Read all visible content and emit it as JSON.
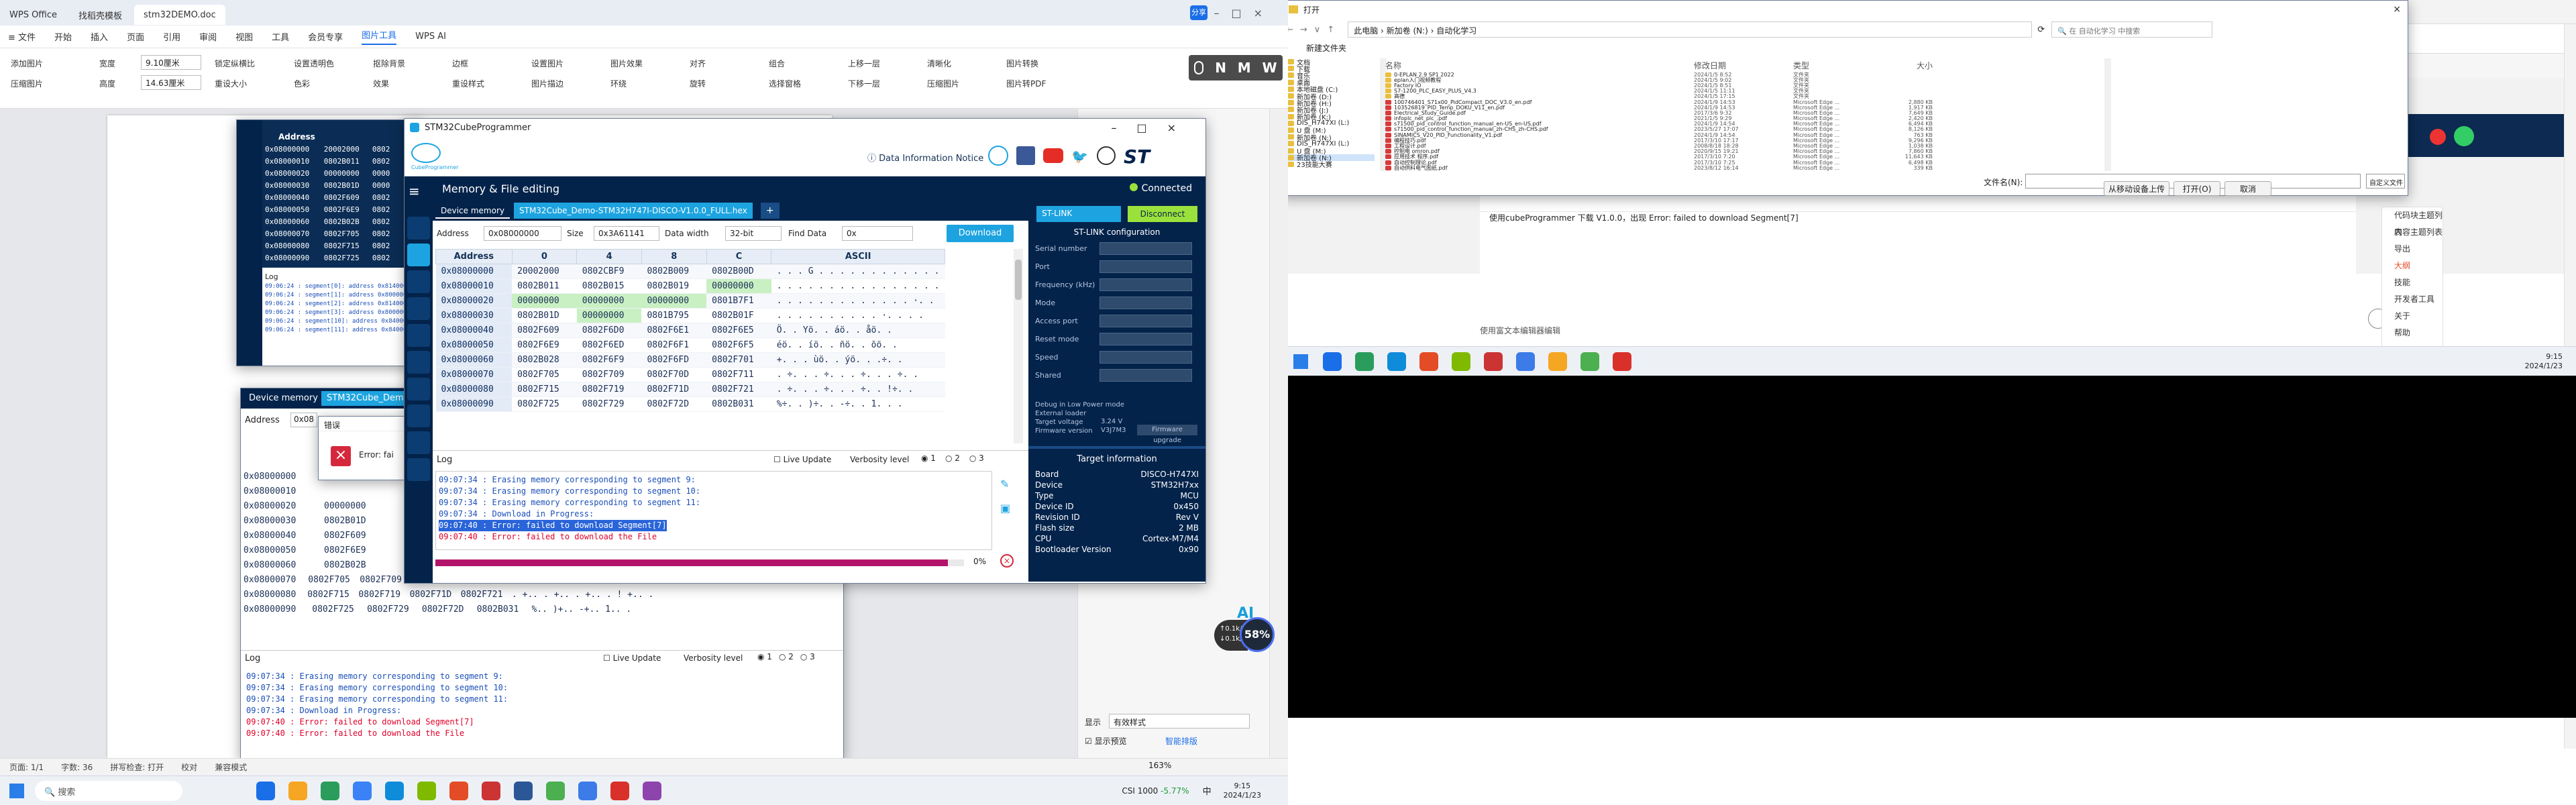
{
  "wps": {
    "tabs": [
      "WPS Office",
      "找稻壳模板",
      "stm32DEMO.doc"
    ],
    "menu": [
      "≡ 文件",
      "开始",
      "插入",
      "页面",
      "引用",
      "审阅",
      "视图",
      "工具",
      "会员专享",
      "图片工具",
      "WPS AI"
    ],
    "share": "分享",
    "ribbon": {
      "a": [
        "添加图片",
        "压缩图片"
      ],
      "w": "宽度",
      "w_val": "9.10厘米",
      "h": "高度",
      "h_val": "14.63厘米",
      "items": [
        "锁定纵横比",
        "重设大小",
        "设置透明色",
        "色彩",
        "抠除背景",
        "效果",
        "边框",
        "重设样式",
        "设置图片",
        "图片描边",
        "图片效果",
        "环绕",
        "对齐",
        "旋转",
        "组合",
        "选择窗格",
        "上移一层",
        "下移一层",
        "清晰化",
        "压缩图片",
        "图片转换",
        "图片转PDF"
      ],
      "nmw": [
        "N",
        "M",
        "W"
      ]
    },
    "status": [
      "页面: 1/1",
      "字数: 36",
      "拼写检查: 打开",
      "校对",
      "兼容模式"
    ],
    "zoom": "163%",
    "tz_label": "显示",
    "tz_val": "有效样式",
    "tz_check": "显示预览",
    "tz_ai": "智能排版"
  },
  "bg_cube": {
    "address": "Address",
    "rows": [
      [
        "0x08000000",
        "20002000",
        "0802"
      ],
      [
        "0x08000010",
        "0802B011",
        "0802"
      ],
      [
        "0x08000020",
        "00000000",
        "0000"
      ],
      [
        "0x08000030",
        "0802B01D",
        "0000"
      ],
      [
        "0x08000040",
        "0802F609",
        "0802"
      ],
      [
        "0x08000050",
        "0802F6E9",
        "0802"
      ],
      [
        "0x08000060",
        "0802B02B",
        "0802"
      ],
      [
        "0x08000070",
        "0802F705",
        "0802"
      ],
      [
        "0x08000080",
        "0802F715",
        "0802"
      ],
      [
        "0x08000090",
        "0802F725",
        "0802"
      ]
    ],
    "log": [
      "09:06:24 : segment[0]: address 0x8140000, size 0x",
      "09:06:24 : segment[1]: address 0x8000000, size 0x",
      "09:06:24 : segment[2]: address 0x8140000, size 0x",
      "09:06:24 : segment[3]: address 0x8000000, size 0x",
      "09:06:24 : segment[10]: address 0x8400000, size 0x",
      "09:06:24 : segment[11]: address 0x8400000, size 0x"
    ],
    "log_title": "Log"
  },
  "cube2": {
    "device_memory": "Device memory",
    "tab_file": "STM32Cube_Dem",
    "address": "Address",
    "addr_val": "0x08",
    "err_title": "错误",
    "err_msg": "Error: fai",
    "rows": [
      [
        "0x08000000",
        "",
        "",
        ""
      ],
      [
        "0x08000010",
        "",
        "",
        ""
      ],
      [
        "0x08000020",
        "00000000",
        "",
        ""
      ],
      [
        "0x08000030",
        "0802B01D",
        "",
        ""
      ],
      [
        "0x08000040",
        "0802F609",
        "",
        ""
      ],
      [
        "0x08000050",
        "0802F6E9",
        "",
        ""
      ],
      [
        "0x08000060",
        "0802B02B",
        "",
        ""
      ],
      [
        "0x08000070",
        "0802F705",
        "0802F709",
        "0802F70D",
        "0802F711",
        ". +.. . +.. . +.. . +.. ."
      ],
      [
        "0x08000080",
        "0802F715",
        "0802F719",
        "0802F71D",
        "0802F721",
        ". +.. . +.. . +.. . ! +.. ."
      ],
      [
        "0x08000090",
        "0802F725",
        "0802F729",
        "0802F72D",
        "0802B031",
        "%.. )+.. -+.. 1.. ."
      ]
    ],
    "log_title": "Log",
    "live_update": "Live Update",
    "verbosity": "Verbosity level",
    "v": [
      "1",
      "2",
      "3"
    ],
    "log": [
      {
        "t": "09:07:34 : Erasing memory corresponding to segment 9:",
        "e": false
      },
      {
        "t": "09:07:34 : Erasing memory corresponding to segment 10:",
        "e": false
      },
      {
        "t": "09:07:34 : Erasing memory corresponding to segment 11:",
        "e": false
      },
      {
        "t": "09:07:34 : Download in Progress:",
        "e": false
      },
      {
        "t": "09:07:40 : Error: failed to download Segment[7]",
        "e": true
      },
      {
        "t": "09:07:40 : Error: failed to download the File",
        "e": true
      }
    ]
  },
  "cube": {
    "title": "STM32CubeProgrammer",
    "logo_sub": "CubeProgrammer",
    "notice": "Data Information Notice",
    "page_title": "Memory & File editing",
    "connected": "Connected",
    "device_memory": "Device memory",
    "tab_file": "STM32Cube_Demo-STM32H747I-DISCO-V1.0.0_FULL.hex",
    "tab_add": "+",
    "address": "Address",
    "addr_val": "0x08000000",
    "size": "Size",
    "size_val": "0x3A61141",
    "data_width": "Data width",
    "dw_val": "32-bit",
    "find": "Find Data",
    "find_val": "0x",
    "download": "Download",
    "cols": [
      "Address",
      "0",
      "4",
      "8",
      "C",
      "ASCII"
    ],
    "rows": [
      [
        "0x08000000",
        "20002000",
        "0802CBF9",
        "0802B009",
        "0802B00D",
        ". .  . G . . . . . . . . . . . ."
      ],
      [
        "0x08000010",
        "0802B011",
        "0802B015",
        "0802B019",
        "00000000",
        ". . . . . . . . . . . . . . . ."
      ],
      [
        "0x08000020",
        "00000000",
        "00000000",
        "00000000",
        "0801B7F1",
        ". . . . . . . . . . . . . ·. ."
      ],
      [
        "0x08000030",
        "0802B01D",
        "00000000",
        "0801B795",
        "0802B01F",
        ". . . . . . . . . . ·. . . ."
      ],
      [
        "0x08000040",
        "0802F609",
        "0802F6D0",
        "0802F6E1",
        "0802F6E5",
        "Ö. . Yö. . áö. . åö. ."
      ],
      [
        "0x08000050",
        "0802F6E9",
        "0802F6ED",
        "0802F6F1",
        "0802F6F5",
        "éö. . íö. . ñö. . õö. ."
      ],
      [
        "0x08000060",
        "0802B028",
        "0802F6F9",
        "0802F6FD",
        "0802F701",
        "+. . . ùö. . ýö. . .÷. ."
      ],
      [
        "0x08000070",
        "0802F705",
        "0802F709",
        "0802F70D",
        "0802F711",
        ". ÷. . . ÷. . . ÷. . . ÷. ."
      ],
      [
        "0x08000080",
        "0802F715",
        "0802F719",
        "0802F71D",
        "0802F721",
        ". ÷. . . ÷. . . ÷. . !÷. ."
      ],
      [
        "0x08000090",
        "0802F725",
        "0802F729",
        "0802F72D",
        "0802B031",
        "%÷. . )÷. . -÷. . 1. . ."
      ]
    ],
    "log_title": "Log",
    "live_update": "Live Update",
    "verbosity": "Verbosity level",
    "v": [
      "1",
      "2",
      "3"
    ],
    "log": [
      {
        "t": "09:07:34 : Erasing memory corresponding to segment 9:",
        "c": "n"
      },
      {
        "t": "09:07:34 : Erasing memory corresponding to segment 10:",
        "c": "n"
      },
      {
        "t": "09:07:34 : Erasing memory corresponding to segment 11:",
        "c": "n"
      },
      {
        "t": "09:07:34 : Download in Progress:",
        "c": "n"
      },
      {
        "t": "09:07:40 : Error: failed to download Segment[7]",
        "c": "h"
      },
      {
        "t": "09:07:40 : Error: failed to download the File",
        "c": "e"
      }
    ],
    "progress": "0%",
    "progress_value": 0.97,
    "conn_type": "ST-LINK",
    "disconnect": "Disconnect",
    "cfg_title": "ST-LINK configuration",
    "cfg": [
      "Serial number",
      "Port",
      "Frequency (kHz)",
      "Mode",
      "Access port",
      "Reset mode",
      "Speed",
      "Shared"
    ],
    "cfg_extra": [
      "Debug in Low Power mode",
      "External loader",
      "Target voltage",
      "Firmware version"
    ],
    "voltage": "3.24 V",
    "fw": "V3J7M3",
    "fw_update": "Firmware upgrade",
    "ti_title": "Target information",
    "ti": [
      [
        "Board",
        "DISCO-H747XI"
      ],
      [
        "Device",
        "STM32H7xx"
      ],
      [
        "Type",
        "MCU"
      ],
      [
        "Device ID",
        "0x450"
      ],
      [
        "Revision ID",
        "Rev V"
      ],
      [
        "Flash size",
        "2 MB"
      ],
      [
        "CPU",
        "Cortex-M7/M4"
      ],
      [
        "Bootloader Version",
        "0x90"
      ]
    ]
  },
  "taskbar_left": {
    "search": "搜索",
    "stock": "CSI 1000",
    "stock_chg": "-5.77%",
    "ime": "中",
    "time": "9:15",
    "date": "2024/1/23"
  },
  "explorer": {
    "title": "打开",
    "path": [
      "此电脑",
      "新加卷 (N:)",
      "自动化学习"
    ],
    "search": "在 自动化学习 中搜索",
    "new_folder": "新建文件夹",
    "cols": [
      "名称",
      "修改日期",
      "类型",
      "大小"
    ],
    "files": [
      {
        "n": "0-EPLAN 2.9 SP1 2022",
        "d": "2024/1/5 8:52",
        "t": "文件夹",
        "s": "",
        "k": "f"
      },
      {
        "n": "eplan入门视频教程",
        "d": "2024/1/5 9:02",
        "t": "文件夹",
        "s": "",
        "k": "f"
      },
      {
        "n": "Factory IO",
        "d": "2024/1/5 8:51",
        "t": "文件夹",
        "s": "",
        "k": "f"
      },
      {
        "n": "S7-1200_PLC_EASY_PLUS_V4.3",
        "d": "2024/1/5 11:11",
        "t": "文件夹",
        "s": "",
        "k": "f"
      },
      {
        "n": "高德",
        "d": "2024/1/5 17:15",
        "t": "文件夹",
        "s": "",
        "k": "f"
      },
      {
        "n": "100746401_S71x00_PidCompact_DOC_V3.0_en.pdf",
        "d": "2024/1/9 14:53",
        "t": "Microsoft Edge ...",
        "s": "2,880 KB",
        "k": "p"
      },
      {
        "n": "103526819_PID_Temp_DOKU_V11_en.pdf",
        "d": "2024/1/9 14:53",
        "t": "Microsoft Edge ...",
        "s": "1,917 KB",
        "k": "p"
      },
      {
        "n": "Electrical_Study_Guide.pdf",
        "d": "2017/3/6 9:32",
        "t": "Microsoft Edge ...",
        "s": "7,649 KB",
        "k": "p"
      },
      {
        "n": "infoplc_net_plc_.pdf",
        "d": "2021/1/5 9:29",
        "t": "Microsoft Edge ...",
        "s": "2,420 KB",
        "k": "p"
      },
      {
        "n": "s71500_pid_control_function_manual_en-US_en-US.pdf",
        "d": "2024/1/9 14:54",
        "t": "Microsoft Edge ...",
        "s": "6,494 KB",
        "k": "p"
      },
      {
        "n": "s71500_pid_control_function_manual_zh-CHS_zh-CHS.pdf",
        "d": "2023/5/27 17:07",
        "t": "Microsoft Edge ...",
        "s": "8,126 KB",
        "k": "p"
      },
      {
        "n": "SINAMICS_V20_PID_Functionality_V1.pdf",
        "d": "2024/1/9 14:54",
        "t": "Microsoft Edge ...",
        "s": "763 KB",
        "k": "p"
      },
      {
        "n": "编程技巧.pdf",
        "d": "2017/3/10 17:17",
        "t": "Microsoft Edge ...",
        "s": "9,296 KB",
        "k": "p"
      },
      {
        "n": "工程设计.pdf",
        "d": "2008/8/18 18:28",
        "t": "Microsoft Edge ...",
        "s": "1,038 KB",
        "k": "p"
      },
      {
        "n": "控制电 omron.pdf",
        "d": "2020/9/15 19:21",
        "t": "Microsoft Edge ...",
        "s": "7,860 KB",
        "k": "p"
      },
      {
        "n": "应用技术 程序.pdf",
        "d": "2017/3/10 7:20",
        "t": "Microsoft Edge ...",
        "s": "11,643 KB",
        "k": "p"
      },
      {
        "n": "自动控制理论.pdf",
        "d": "2017/3/10 7:25",
        "t": "Microsoft Edge ...",
        "s": "6,498 KB",
        "k": "p"
      },
      {
        "n": "自动供料电气图纸.pdf",
        "d": "2023/8/12 16:14",
        "t": "Microsoft Edge ...",
        "s": "339 KB",
        "k": "p"
      }
    ],
    "tree": [
      "文档",
      "下载",
      "音乐",
      "桌面",
      "本地磁盘 (C:)",
      "新加卷 (D:)",
      "新加卷 (H:)",
      "新加卷 (J:)",
      "新加卷 (K:)",
      "DIS_H747XI (L:)",
      "U 盘 (M:)",
      "新加卷 (N:)",
      "DIS_H747XI (L:)",
      "U 盘 (M:)",
      "新加卷 (N:)",
      "23技能大赛"
    ],
    "filename_label": "文件名(N):",
    "filter": "自定义文件 (*.elf;*.bin;*.hex;*.bmp;*.",
    "phone": "从移动设备上传",
    "open": "打开(O)",
    "cancel": "取消"
  },
  "right_doc": {
    "text": "使用cubeProgrammer 下载 V1.0.0，出现 Error: failed to download Segment[7]",
    "bottom": "使用富文本编辑器编辑",
    "ctx": [
      "代码块主题列表",
      "内容主题列表",
      "导出",
      "大纲",
      "技能",
      "开发者工具",
      "关于",
      "帮助"
    ]
  },
  "taskbar_right": {
    "time": "9:15",
    "date": "2024/1/23"
  },
  "speed": {
    "up": "0.1k/s",
    "down": "0.1k/s",
    "pct": "58%"
  }
}
